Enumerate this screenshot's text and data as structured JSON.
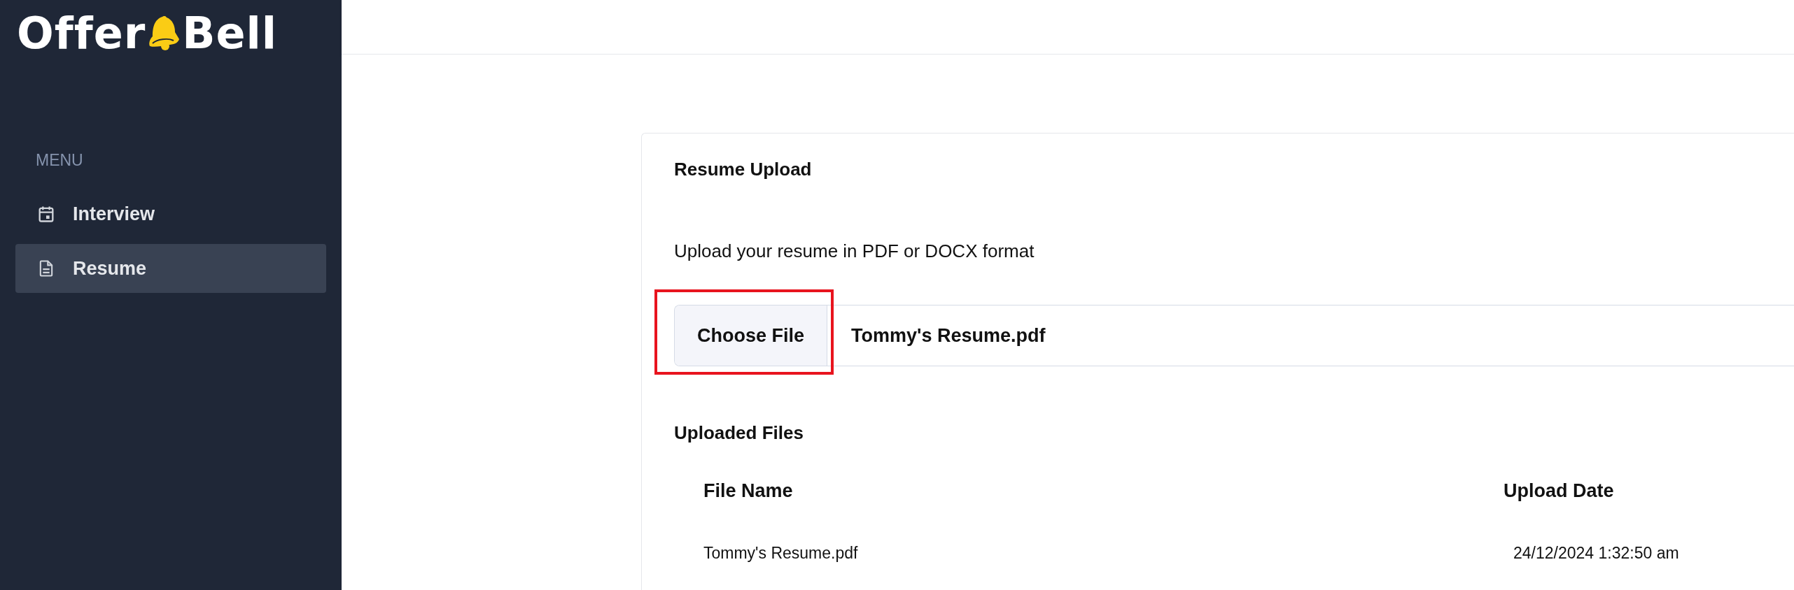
{
  "logo": {
    "before_icon": "Offer",
    "after_icon": "Bell"
  },
  "sidebar": {
    "heading": "MENU",
    "items": [
      {
        "label": "Interview",
        "selected": false
      },
      {
        "label": "Resume",
        "selected": true
      }
    ]
  },
  "card": {
    "title": "Resume Upload",
    "description": "Upload your resume in PDF or DOCX format",
    "file_input": {
      "button": "Choose File",
      "value": "Tommy's Resume.pdf",
      "highlighted": true
    },
    "uploaded": {
      "title": "Uploaded Files",
      "columns": [
        "File Name",
        "Upload Date"
      ],
      "rows": [
        [
          "Tommy's Resume.pdf",
          "24/12/2024 1:32:50 am"
        ]
      ]
    }
  }
}
